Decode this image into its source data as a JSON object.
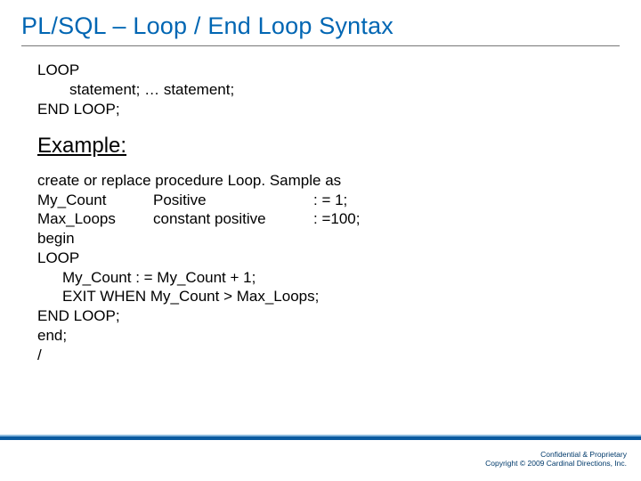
{
  "title": "PL/SQL – Loop / End Loop Syntax",
  "syntax": {
    "line1": "LOOP",
    "line2": "statement; … statement;",
    "line3": "END LOOP;"
  },
  "example_label": "Example:",
  "code": {
    "l1": "create or replace procedure Loop. Sample as",
    "decl1_a": "My_Count",
    "decl1_b": "Positive",
    "decl1_c": ": = 1;",
    "decl2_a": "Max_Loops",
    "decl2_b": "constant positive",
    "decl2_c": ": =100;",
    "l4": "begin",
    "l5": "LOOP",
    "l6": "My_Count : = My_Count + 1;",
    "l7": "EXIT WHEN My_Count > Max_Loops;",
    "l8": "END LOOP;",
    "l9": "end;",
    "l10": "/"
  },
  "footer": {
    "line1": "Confidential & Proprietary",
    "line2": "Copyright © 2009 Cardinal Directions, Inc."
  }
}
